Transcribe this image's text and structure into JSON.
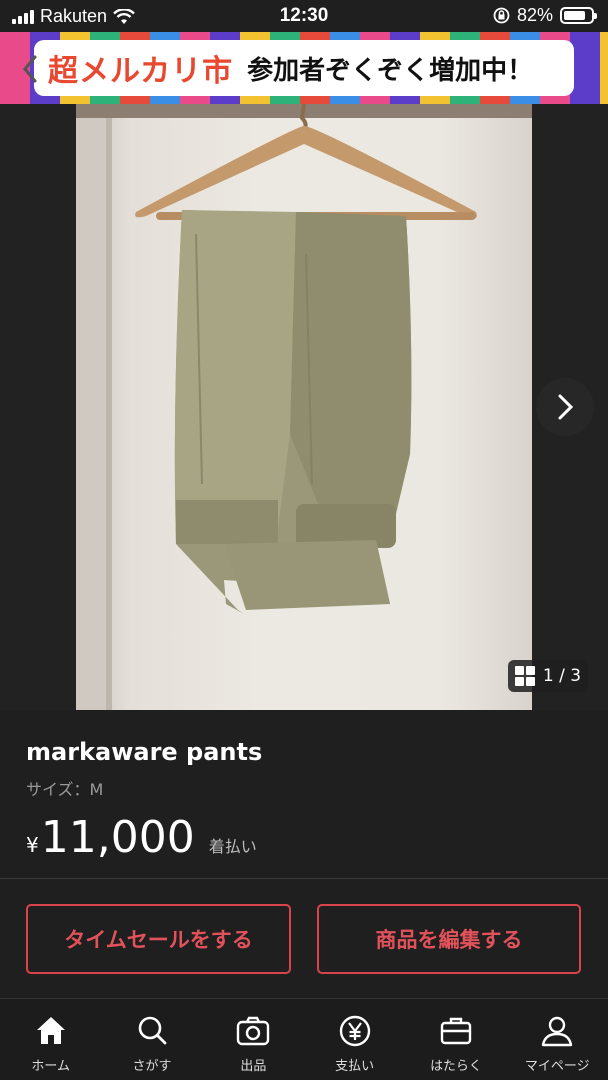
{
  "status_bar": {
    "carrier": "Rakuten",
    "time": "12:30",
    "battery_percent": "82%",
    "battery_level": 0.82
  },
  "banner": {
    "logo": "超メルカリ市",
    "text": "参加者ぞくぞく増加中！"
  },
  "gallery": {
    "counter": "1 / 3"
  },
  "item": {
    "title": "markaware pants",
    "size": "サイズ：M",
    "price_symbol": "¥",
    "price": "11,000",
    "shipping": "着払い"
  },
  "actions": {
    "time_sale": "タイムセールをする",
    "edit": "商品を編集する"
  },
  "tabs": [
    {
      "label": "ホーム",
      "icon": "home-icon"
    },
    {
      "label": "さがす",
      "icon": "search-icon"
    },
    {
      "label": "出品",
      "icon": "camera-icon"
    },
    {
      "label": "支払い",
      "icon": "yen-icon"
    },
    {
      "label": "はたらく",
      "icon": "briefcase-icon"
    },
    {
      "label": "マイページ",
      "icon": "person-icon"
    }
  ],
  "colors": {
    "background": "#1f1f1f",
    "accent": "#d9434c"
  }
}
